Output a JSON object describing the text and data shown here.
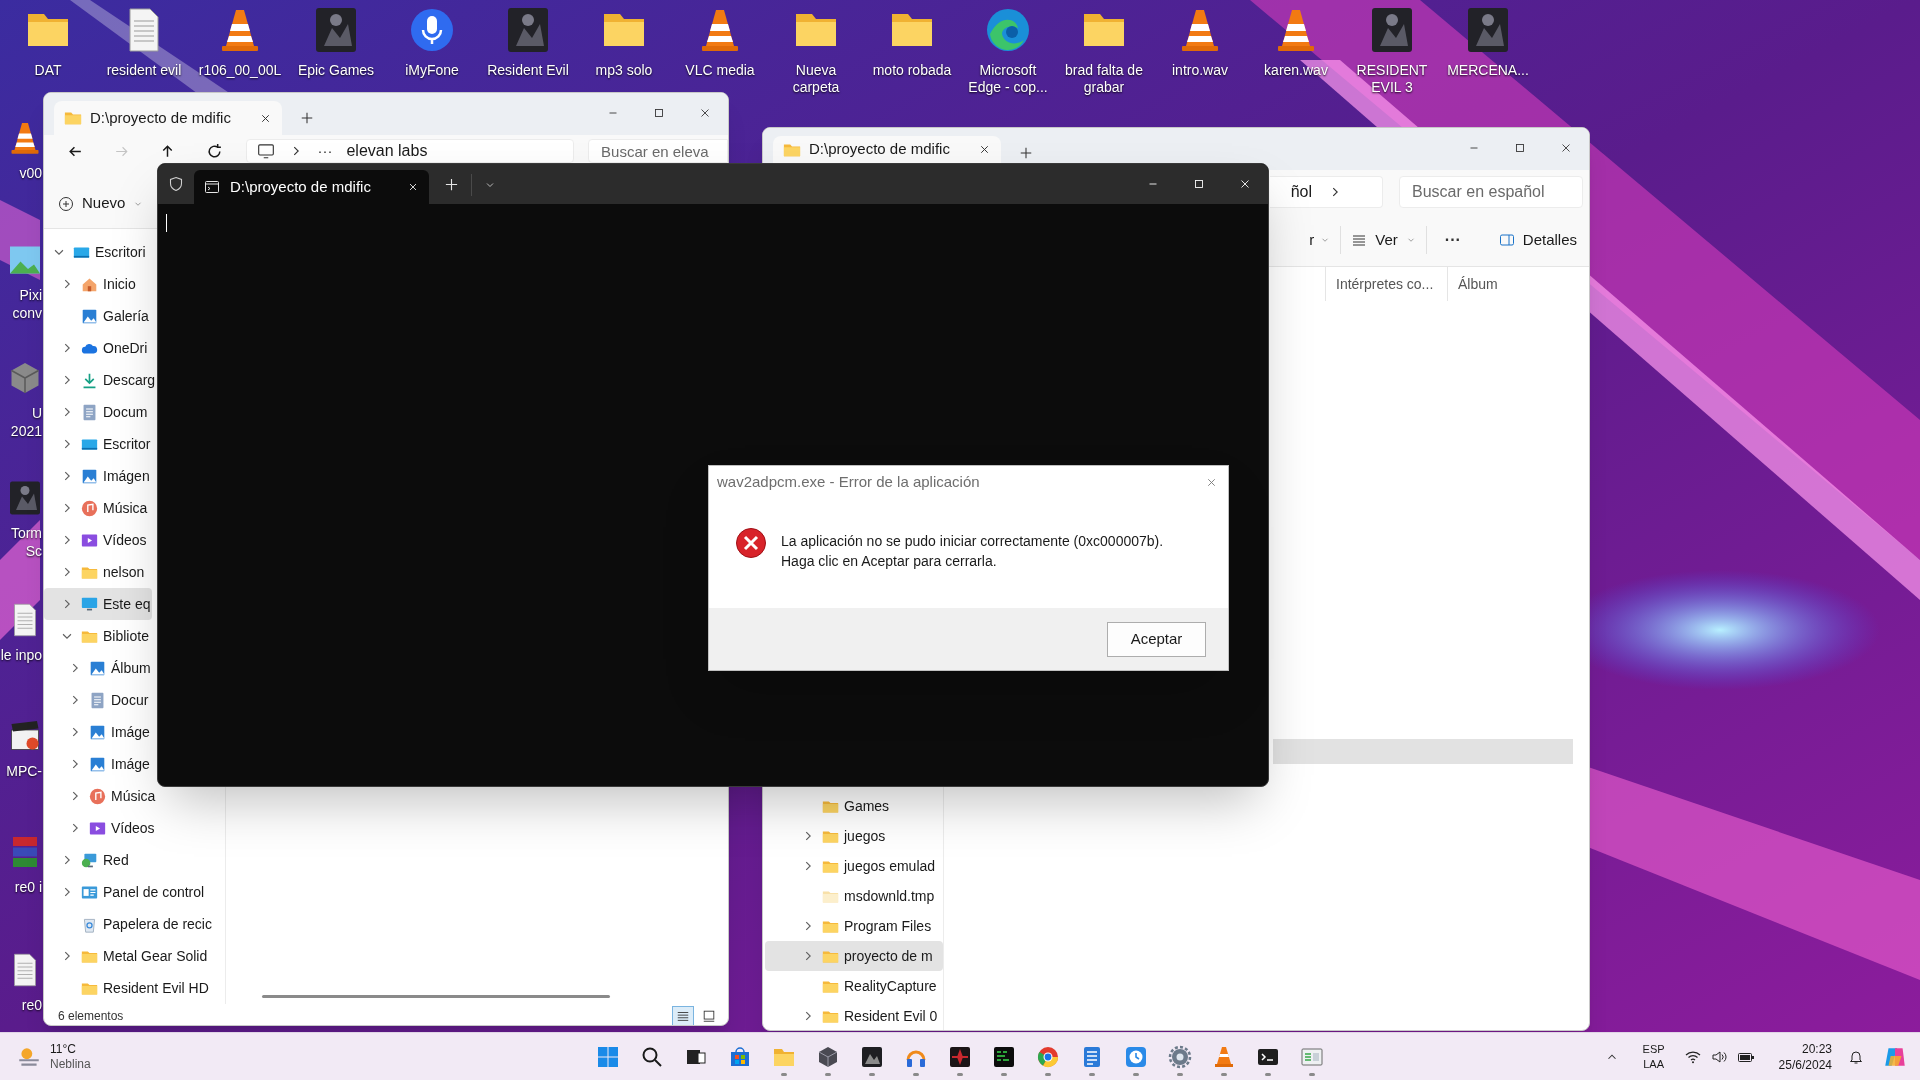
{
  "desktop": {
    "top_icons": [
      {
        "label": "DAT",
        "kind": "folder"
      },
      {
        "label": "resident evil",
        "kind": "file"
      },
      {
        "label": "r106_00_00L",
        "kind": "cone"
      },
      {
        "label": "Epic Games",
        "kind": "tile"
      },
      {
        "label": "iMyFone",
        "kind": "mic"
      },
      {
        "label": "Resident Evil",
        "kind": "tile"
      },
      {
        "label": "mp3 solo",
        "kind": "folder"
      },
      {
        "label": "VLC media",
        "kind": "cone"
      },
      {
        "label": "Nueva carpeta",
        "kind": "folder"
      },
      {
        "label": "moto robada",
        "kind": "folder"
      },
      {
        "label": "Microsoft Edge - cop...",
        "kind": "edge"
      },
      {
        "label": "brad falta de grabar",
        "kind": "folder"
      },
      {
        "label": "intro.wav",
        "kind": "cone"
      },
      {
        "label": "karen.wav",
        "kind": "cone"
      },
      {
        "label": "RESIDENT EVIL 3",
        "kind": "tile"
      },
      {
        "label": "MERCENA...",
        "kind": "tile"
      }
    ],
    "side_icons": [
      {
        "label": "v00",
        "kind": "cone"
      },
      {
        "label": "Pixi conv"
      },
      {
        "label": "U 2021",
        "kind": "box"
      },
      {
        "label": "Torm Sc",
        "kind": "tile"
      },
      {
        "label": "le inpo",
        "kind": "file"
      },
      {
        "label": "MPC-",
        "kind": "clapper"
      },
      {
        "label": "re0 i",
        "kind": "archive"
      },
      {
        "label": "re0",
        "kind": "file"
      }
    ]
  },
  "explorer_left": {
    "tab_title": "D:\\proyecto de mdific",
    "nav_buttons": [
      {
        "kind": "back",
        "disabled": false
      },
      {
        "kind": "forward",
        "disabled": true
      },
      {
        "kind": "up",
        "disabled": false
      },
      {
        "kind": "refresh",
        "disabled": false
      }
    ],
    "address": {
      "overflow": "···",
      "segment": "elevan labs"
    },
    "search": {
      "placeholder": "Buscar en eleva"
    },
    "new_button": "Nuevo",
    "tree": [
      {
        "label": "Escritori",
        "kind": "desktop",
        "expandable": true,
        "expanded": true,
        "selected": false,
        "children": [
          {
            "label": "Inicio",
            "kind": "home",
            "expandable": true,
            "expanded": false,
            "selected": false
          },
          {
            "label": "Galería",
            "kind": "gallery",
            "expandable": false,
            "selected": false
          },
          {
            "label": "OneDri",
            "kind": "cloud",
            "expandable": true,
            "expanded": false,
            "selected": false
          },
          {
            "label": "Descarg",
            "kind": "download",
            "expandable": true,
            "expanded": false,
            "selected": false
          },
          {
            "label": "Docum",
            "kind": "document",
            "expandable": true,
            "expanded": false,
            "selected": false
          },
          {
            "label": "Escritor",
            "kind": "desktop",
            "expandable": true,
            "expanded": false,
            "selected": false
          },
          {
            "label": "Imágen",
            "kind": "gallery",
            "expandable": true,
            "expanded": false,
            "selected": false
          },
          {
            "label": "Música",
            "kind": "music",
            "expandable": true,
            "expanded": false,
            "selected": false
          },
          {
            "label": "Vídeos",
            "kind": "videos",
            "expandable": true,
            "expanded": false,
            "selected": false
          },
          {
            "label": "nelson",
            "kind": "folder",
            "expandable": true,
            "expanded": false,
            "selected": false
          },
          {
            "label": "Este eq",
            "kind": "computer",
            "expandable": true,
            "expanded": false,
            "selected": true
          },
          {
            "label": "Bibliote",
            "kind": "folder",
            "expandable": true,
            "expanded": true,
            "selected": false,
            "children": [
              {
                "label": "Álbum",
                "kind": "gallery",
                "expandable": true,
                "expanded": false,
                "selected": false
              },
              {
                "label": "Docur",
                "kind": "document",
                "expandable": true,
                "expanded": false,
                "selected": false
              },
              {
                "label": "Imáge",
                "kind": "gallery",
                "expandable": true,
                "expanded": false,
                "selected": false
              },
              {
                "label": "Imáge",
                "kind": "gallery",
                "expandable": true,
                "expanded": false,
                "selected": false
              },
              {
                "label": "Música",
                "kind": "music",
                "expandable": true,
                "expanded": false,
                "selected": false
              },
              {
                "label": "Vídeos",
                "kind": "videos",
                "expandable": true,
                "expanded": false,
                "selected": false
              }
            ]
          },
          {
            "label": "Red",
            "kind": "network",
            "expandable": true,
            "expanded": false,
            "selected": false
          },
          {
            "label": "Panel de control",
            "kind": "control",
            "expandable": true,
            "expanded": false,
            "selected": false
          },
          {
            "label": "Papelera de recic",
            "kind": "recycle",
            "expandable": false,
            "selected": false
          },
          {
            "label": "Metal Gear Solid",
            "kind": "folder",
            "expandable": true,
            "expanded": false,
            "selected": false
          },
          {
            "label": "Resident Evil HD",
            "kind": "folder",
            "expandable": false,
            "selected": false
          }
        ]
      }
    ],
    "status": "6 elementos",
    "view_buttons": [
      {
        "kind": "details",
        "selected": true
      },
      {
        "kind": "tiles",
        "selected": false
      }
    ]
  },
  "explorer_right": {
    "tab_title": "D:\\proyecto de mdific",
    "address": {
      "segment": "ñol"
    },
    "search": {
      "placeholder": "Buscar en español"
    },
    "commands": [
      {
        "kind": "menu",
        "label": "r"
      },
      {
        "kind": "view",
        "label": "Ver"
      },
      {
        "kind": "more",
        "label": "···"
      },
      {
        "kind": "details",
        "label": "Detalles"
      }
    ],
    "columns": [
      "Intérpretes co...",
      "Álbum"
    ],
    "tree": [
      {
        "label": "Games",
        "kind": "folder",
        "expandable": false,
        "selected": false
      },
      {
        "label": "juegos",
        "kind": "folder",
        "expandable": true,
        "expanded": false,
        "selected": false
      },
      {
        "label": "juegos emulad",
        "kind": "folder",
        "expandable": true,
        "expanded": false,
        "selected": false
      },
      {
        "label": "msdownld.tmp",
        "kind": "hidden-folder",
        "expandable": false,
        "selected": false
      },
      {
        "label": "Program Files",
        "kind": "folder",
        "expandable": true,
        "expanded": false,
        "selected": false
      },
      {
        "label": "proyecto de m",
        "kind": "folder",
        "expandable": true,
        "expanded": false,
        "selected": true
      },
      {
        "label": "RealityCapture",
        "kind": "folder",
        "expandable": false,
        "selected": false
      },
      {
        "label": "Resident Evil 0",
        "kind": "folder",
        "expandable": true,
        "expanded": false,
        "selected": false
      }
    ]
  },
  "terminal": {
    "tab_title": "D:\\proyecto de mdific"
  },
  "dialog": {
    "title": "wav2adpcm.exe - Error de la aplicación",
    "message": [
      "La aplicación no se pudo iniciar correctamente (0xc000007b).",
      "Haga clic en Aceptar para cerrarla."
    ],
    "button": "Aceptar"
  },
  "taskbar": {
    "weather": {
      "temperature": "11°C",
      "condition": "Neblina"
    },
    "apps": [
      {
        "kind": "start",
        "running": false
      },
      {
        "kind": "search",
        "running": false
      },
      {
        "kind": "taskview",
        "running": false
      },
      {
        "kind": "store",
        "running": false
      },
      {
        "kind": "folder",
        "running": true
      },
      {
        "kind": "cube",
        "running": true
      },
      {
        "kind": "tile-dark",
        "running": true
      },
      {
        "kind": "headphones",
        "running": true
      },
      {
        "kind": "tile-red",
        "running": true
      },
      {
        "kind": "tile-green",
        "running": true
      },
      {
        "kind": "chrome",
        "running": true
      },
      {
        "kind": "notepad",
        "running": true
      },
      {
        "kind": "clock",
        "running": true
      },
      {
        "kind": "gear",
        "running": true
      },
      {
        "kind": "cone",
        "running": true
      },
      {
        "kind": "terminal",
        "running": true
      },
      {
        "kind": "window",
        "running": true
      }
    ],
    "language": "ESP",
    "layout": "LAA",
    "time": "20:23",
    "date": "25/6/2024"
  }
}
